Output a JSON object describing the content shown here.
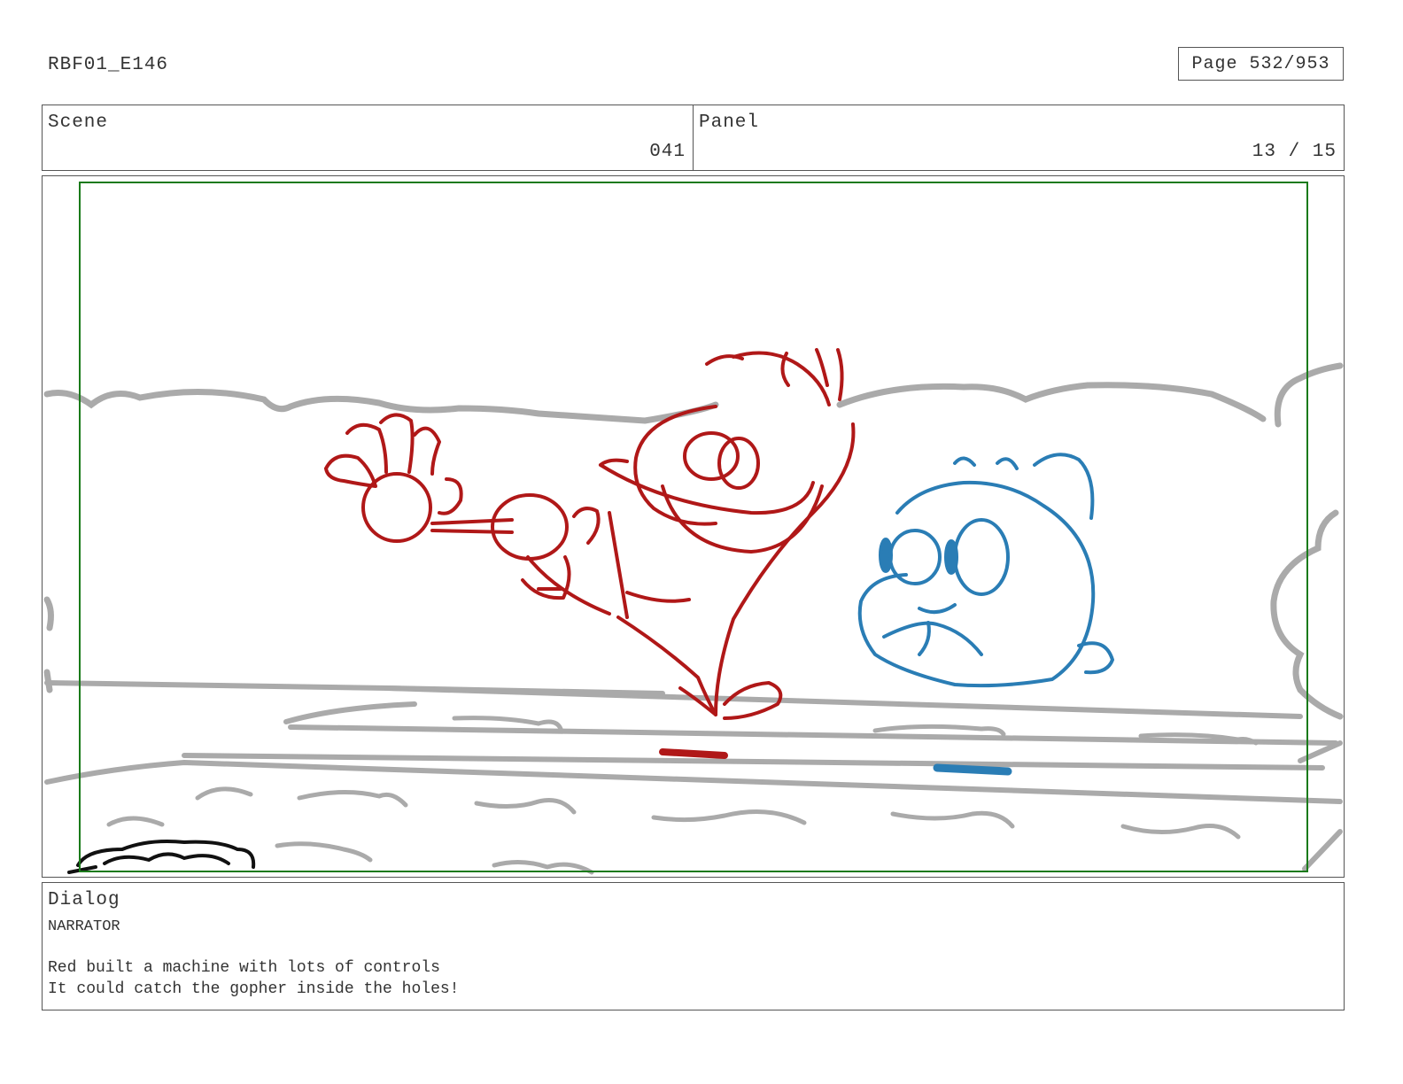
{
  "header": {
    "episode_id": "RBF01_E146",
    "page_label": "Page 532/953"
  },
  "info": {
    "scene_label": "Scene",
    "scene_value": "041",
    "panel_label": "Panel",
    "panel_value": "13 / 15"
  },
  "panel_drawing": {
    "description_icon": "storyboard-sketch",
    "colors": {
      "red_character": "#b01818",
      "blue_character": "#2a7db5",
      "background": "#aaaaaa",
      "safe_frame": "#1a7a1a",
      "foreground": "#111111"
    }
  },
  "dialog": {
    "label": "Dialog",
    "speaker": "NARRATOR",
    "lines": [
      "Red built a machine with lots of controls",
      "It could catch the gopher inside the holes!"
    ]
  }
}
